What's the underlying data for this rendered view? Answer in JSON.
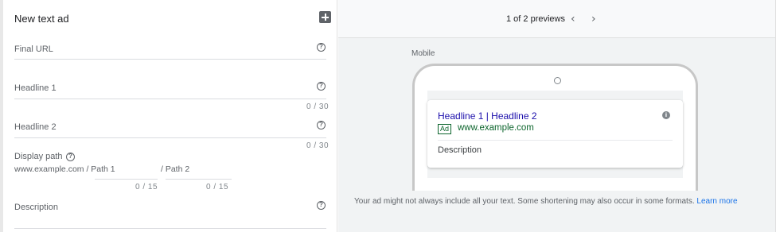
{
  "editor": {
    "title": "New text ad",
    "fields": {
      "final_url": {
        "label": "Final URL"
      },
      "headline1": {
        "label": "Headline 1",
        "counter": "0 / 30"
      },
      "headline2": {
        "label": "Headline 2",
        "counter": "0 / 30"
      },
      "description": {
        "label": "Description"
      }
    },
    "display_path": {
      "label": "Display path",
      "base_url": "www.example.com / Path 1",
      "path2": "/ Path 2",
      "path1_counter": "0 / 15",
      "path2_counter": "0 / 15"
    },
    "help_glyph": "?"
  },
  "preview": {
    "count_text": "1 of 2 previews",
    "prev_icon": "‹",
    "next_icon": "›",
    "device_label": "Mobile",
    "ad": {
      "headline": "Headline 1 | Headline 2",
      "badge": "Ad",
      "display_url": "www.example.com",
      "description": "Description",
      "info_glyph": "i"
    },
    "note": "Your ad might not always include all your text. Some shortening may also occur in some formats.",
    "learn_more": "Learn more"
  },
  "colors": {
    "headline_link": "#1a0dab",
    "display_url": "#0d652d",
    "learn_more": "#1a73e8"
  }
}
